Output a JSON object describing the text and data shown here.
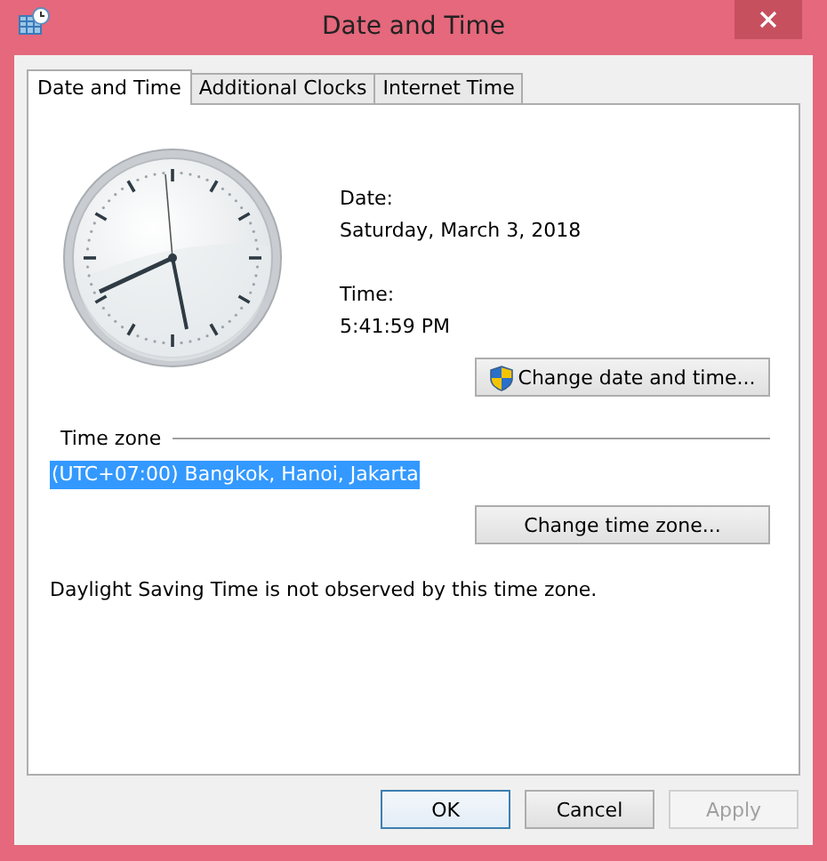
{
  "window": {
    "title": "Date and Time"
  },
  "tabs": [
    {
      "label": "Date and Time",
      "selected": true
    },
    {
      "label": "Additional Clocks",
      "selected": false
    },
    {
      "label": "Internet Time",
      "selected": false
    }
  ],
  "date": {
    "label": "Date:",
    "value": "Saturday, March 3, 2018"
  },
  "time": {
    "label": "Time:",
    "value": "5:41:59 PM"
  },
  "change_date_button": "Change date and time...",
  "time_zone": {
    "heading": "Time zone",
    "value": "(UTC+07:00) Bangkok, Hanoi, Jakarta",
    "selected": true,
    "button": "Change time zone..."
  },
  "dst_note": "Daylight Saving Time is not observed by this time zone.",
  "buttons": [
    {
      "label": "OK",
      "default": true,
      "disabled": false
    },
    {
      "label": "Cancel",
      "default": false,
      "disabled": false
    },
    {
      "label": "Apply",
      "default": false,
      "disabled": true
    }
  ]
}
